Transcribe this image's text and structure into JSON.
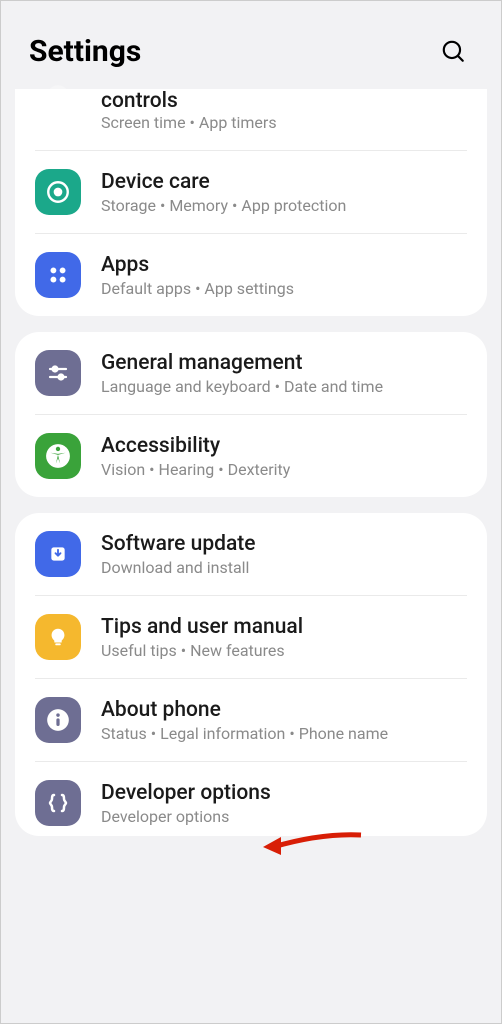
{
  "header": {
    "title": "Settings"
  },
  "groups": [
    {
      "items": [
        {
          "partial": true,
          "icon_bg": "#1f9f5f",
          "title": "controls",
          "subtitle": "Screen time  •  App timers"
        },
        {
          "icon_bg": "#1ba88a",
          "icon_id": "device-care-icon",
          "title": "Device care",
          "subtitle": "Storage  •  Memory  •  App protection"
        },
        {
          "icon_bg": "#4169e8",
          "icon_id": "apps-icon",
          "title": "Apps",
          "subtitle": "Default apps  •  App settings"
        }
      ]
    },
    {
      "items": [
        {
          "icon_bg": "#6e6e93",
          "icon_id": "sliders-icon",
          "title": "General management",
          "subtitle": "Language and keyboard  •  Date and time"
        },
        {
          "icon_bg": "#3aa33a",
          "icon_id": "accessibility-icon",
          "title": "Accessibility",
          "subtitle": "Vision  •  Hearing  •  Dexterity"
        }
      ]
    },
    {
      "items": [
        {
          "icon_bg": "#4169e8",
          "icon_id": "download-icon",
          "title": "Software update",
          "subtitle": "Download and install"
        },
        {
          "icon_bg": "#f5b82e",
          "icon_id": "lightbulb-icon",
          "title": "Tips and user manual",
          "subtitle": "Useful tips  •  New features"
        },
        {
          "icon_bg": "#6e6e93",
          "icon_id": "info-icon",
          "title": "About phone",
          "subtitle": "Status  •  Legal information  •  Phone name"
        },
        {
          "icon_bg": "#6e6e93",
          "icon_id": "braces-icon",
          "title": "Developer options",
          "subtitle": "Developer options"
        }
      ]
    }
  ]
}
